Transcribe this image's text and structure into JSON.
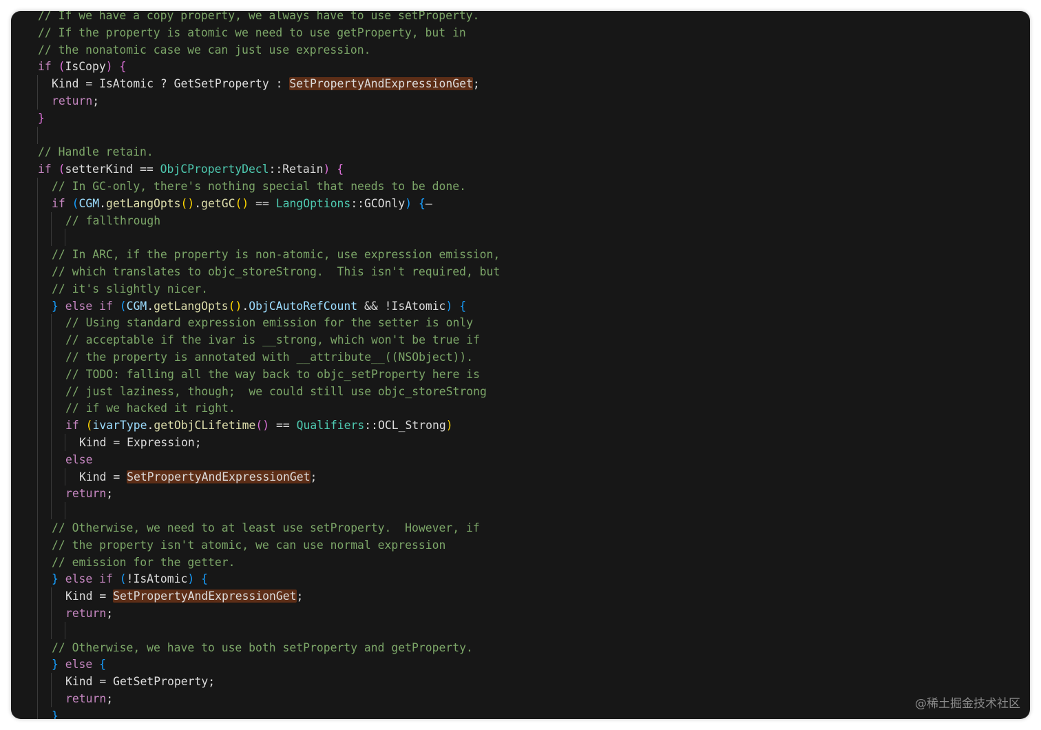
{
  "editor": {
    "lines": [
      {
        "indent": 1,
        "tokens": [
          {
            "t": "// If we have a copy property, we always have to use setProperty.",
            "c": "comment"
          }
        ]
      },
      {
        "indent": 1,
        "tokens": [
          {
            "t": "// If the property is atomic we need to use getProperty, but in",
            "c": "comment"
          }
        ]
      },
      {
        "indent": 1,
        "tokens": [
          {
            "t": "// the nonatomic case we can just use expression.",
            "c": "comment"
          }
        ]
      },
      {
        "indent": 1,
        "tokens": [
          {
            "t": "if",
            "c": "keyword"
          },
          {
            "t": " ",
            "c": "text"
          },
          {
            "t": "(",
            "c": "brace1"
          },
          {
            "t": "IsCopy",
            "c": "text"
          },
          {
            "t": ")",
            "c": "brace1"
          },
          {
            "t": " ",
            "c": "text"
          },
          {
            "t": "{",
            "c": "brace1"
          }
        ]
      },
      {
        "indent": 2,
        "tokens": [
          {
            "t": "Kind = IsAtomic ? GetSetProperty : ",
            "c": "text"
          },
          {
            "t": "SetPropertyAndExpressionGet",
            "c": "hl"
          },
          {
            "t": ";",
            "c": "text"
          }
        ]
      },
      {
        "indent": 2,
        "tokens": [
          {
            "t": "return",
            "c": "keyword"
          },
          {
            "t": ";",
            "c": "text"
          }
        ]
      },
      {
        "indent": 1,
        "tokens": [
          {
            "t": "}",
            "c": "brace1"
          }
        ]
      },
      {
        "indent": 1,
        "tokens": []
      },
      {
        "indent": 1,
        "tokens": [
          {
            "t": "// Handle retain.",
            "c": "comment"
          }
        ]
      },
      {
        "indent": 1,
        "tokens": [
          {
            "t": "if",
            "c": "keyword"
          },
          {
            "t": " ",
            "c": "text"
          },
          {
            "t": "(",
            "c": "brace1"
          },
          {
            "t": "setterKind == ",
            "c": "text"
          },
          {
            "t": "ObjCPropertyDecl",
            "c": "type"
          },
          {
            "t": "::Retain",
            "c": "text"
          },
          {
            "t": ")",
            "c": "brace1"
          },
          {
            "t": " ",
            "c": "text"
          },
          {
            "t": "{",
            "c": "brace1"
          }
        ]
      },
      {
        "indent": 2,
        "tokens": [
          {
            "t": "// In GC-only, there's nothing special that needs to be done.",
            "c": "comment"
          }
        ]
      },
      {
        "indent": 2,
        "tokens": [
          {
            "t": "if",
            "c": "keyword"
          },
          {
            "t": " ",
            "c": "text"
          },
          {
            "t": "(",
            "c": "brace2"
          },
          {
            "t": "CGM",
            "c": "var"
          },
          {
            "t": ".",
            "c": "text"
          },
          {
            "t": "getLangOpts",
            "c": "func"
          },
          {
            "t": "()",
            "c": "brace3"
          },
          {
            "t": ".",
            "c": "text"
          },
          {
            "t": "getGC",
            "c": "func"
          },
          {
            "t": "()",
            "c": "brace3"
          },
          {
            "t": " == ",
            "c": "text"
          },
          {
            "t": "LangOptions",
            "c": "type"
          },
          {
            "t": "::GCOnly",
            "c": "text"
          },
          {
            "t": ")",
            "c": "brace2"
          },
          {
            "t": " ",
            "c": "text"
          },
          {
            "t": "{",
            "c": "brace2"
          },
          {
            "t": "—",
            "c": "text"
          }
        ]
      },
      {
        "indent": 3,
        "tokens": [
          {
            "t": "// fallthrough",
            "c": "comment"
          }
        ]
      },
      {
        "indent": 3,
        "tokens": []
      },
      {
        "indent": 2,
        "tokens": [
          {
            "t": "// In ARC, if the property is non-atomic, use expression emission,",
            "c": "comment"
          }
        ]
      },
      {
        "indent": 2,
        "tokens": [
          {
            "t": "// which translates to objc_storeStrong.  This isn't required, but",
            "c": "comment"
          }
        ]
      },
      {
        "indent": 2,
        "tokens": [
          {
            "t": "// it's slightly nicer.",
            "c": "comment"
          }
        ]
      },
      {
        "indent": 2,
        "tokens": [
          {
            "t": "}",
            "c": "brace2"
          },
          {
            "t": " ",
            "c": "text"
          },
          {
            "t": "else if",
            "c": "keyword"
          },
          {
            "t": " ",
            "c": "text"
          },
          {
            "t": "(",
            "c": "brace2"
          },
          {
            "t": "CGM",
            "c": "var"
          },
          {
            "t": ".",
            "c": "text"
          },
          {
            "t": "getLangOpts",
            "c": "func"
          },
          {
            "t": "()",
            "c": "brace3"
          },
          {
            "t": ".",
            "c": "text"
          },
          {
            "t": "ObjCAutoRefCount",
            "c": "var"
          },
          {
            "t": " && !IsAtomic",
            "c": "text"
          },
          {
            "t": ")",
            "c": "brace2"
          },
          {
            "t": " ",
            "c": "text"
          },
          {
            "t": "{",
            "c": "brace2"
          }
        ]
      },
      {
        "indent": 3,
        "tokens": [
          {
            "t": "// Using standard expression emission for the setter is only",
            "c": "comment"
          }
        ]
      },
      {
        "indent": 3,
        "tokens": [
          {
            "t": "// acceptable if the ivar is __strong, which won't be true if",
            "c": "comment"
          }
        ]
      },
      {
        "indent": 3,
        "tokens": [
          {
            "t": "// the property is annotated with __attribute__((NSObject)).",
            "c": "comment"
          }
        ]
      },
      {
        "indent": 3,
        "tokens": [
          {
            "t": "// TODO: falling all the way back to objc_setProperty here is",
            "c": "comment"
          }
        ]
      },
      {
        "indent": 3,
        "tokens": [
          {
            "t": "// just laziness, though;  we could still use objc_storeStrong",
            "c": "comment"
          }
        ]
      },
      {
        "indent": 3,
        "tokens": [
          {
            "t": "// if we hacked it right.",
            "c": "comment"
          }
        ]
      },
      {
        "indent": 3,
        "tokens": [
          {
            "t": "if",
            "c": "keyword"
          },
          {
            "t": " ",
            "c": "text"
          },
          {
            "t": "(",
            "c": "brace3"
          },
          {
            "t": "ivarType",
            "c": "var"
          },
          {
            "t": ".",
            "c": "text"
          },
          {
            "t": "getObjCLifetime",
            "c": "func"
          },
          {
            "t": "()",
            "c": "brace1"
          },
          {
            "t": " == ",
            "c": "text"
          },
          {
            "t": "Qualifiers",
            "c": "type"
          },
          {
            "t": "::OCL_Strong",
            "c": "text"
          },
          {
            "t": ")",
            "c": "brace3"
          }
        ]
      },
      {
        "indent": 4,
        "tokens": [
          {
            "t": "Kind = Expression;",
            "c": "text"
          }
        ]
      },
      {
        "indent": 3,
        "tokens": [
          {
            "t": "else",
            "c": "keyword"
          }
        ]
      },
      {
        "indent": 4,
        "tokens": [
          {
            "t": "Kind = ",
            "c": "text"
          },
          {
            "t": "SetPropertyAndExpressionGet",
            "c": "hl"
          },
          {
            "t": ";",
            "c": "text"
          }
        ]
      },
      {
        "indent": 3,
        "tokens": [
          {
            "t": "return",
            "c": "keyword"
          },
          {
            "t": ";",
            "c": "text"
          }
        ]
      },
      {
        "indent": 3,
        "tokens": []
      },
      {
        "indent": 2,
        "tokens": [
          {
            "t": "// Otherwise, we need to at least use setProperty.  However, if",
            "c": "comment"
          }
        ]
      },
      {
        "indent": 2,
        "tokens": [
          {
            "t": "// the property isn't atomic, we can use normal expression",
            "c": "comment"
          }
        ]
      },
      {
        "indent": 2,
        "tokens": [
          {
            "t": "// emission for the getter.",
            "c": "comment"
          }
        ]
      },
      {
        "indent": 2,
        "tokens": [
          {
            "t": "}",
            "c": "brace2"
          },
          {
            "t": " ",
            "c": "text"
          },
          {
            "t": "else if",
            "c": "keyword"
          },
          {
            "t": " ",
            "c": "text"
          },
          {
            "t": "(",
            "c": "brace2"
          },
          {
            "t": "!IsAtomic",
            "c": "text"
          },
          {
            "t": ")",
            "c": "brace2"
          },
          {
            "t": " ",
            "c": "text"
          },
          {
            "t": "{",
            "c": "brace2"
          }
        ]
      },
      {
        "indent": 3,
        "tokens": [
          {
            "t": "Kind = ",
            "c": "text"
          },
          {
            "t": "SetPropertyAndExpressionGet",
            "c": "hl"
          },
          {
            "t": ";",
            "c": "text"
          }
        ]
      },
      {
        "indent": 3,
        "tokens": [
          {
            "t": "return",
            "c": "keyword"
          },
          {
            "t": ";",
            "c": "text"
          }
        ]
      },
      {
        "indent": 3,
        "tokens": []
      },
      {
        "indent": 2,
        "tokens": [
          {
            "t": "// Otherwise, we have to use both setProperty and getProperty.",
            "c": "comment"
          }
        ]
      },
      {
        "indent": 2,
        "tokens": [
          {
            "t": "}",
            "c": "brace2"
          },
          {
            "t": " ",
            "c": "text"
          },
          {
            "t": "else",
            "c": "keyword"
          },
          {
            "t": " ",
            "c": "text"
          },
          {
            "t": "{",
            "c": "brace2"
          }
        ]
      },
      {
        "indent": 3,
        "tokens": [
          {
            "t": "Kind = GetSetProperty;",
            "c": "text"
          }
        ]
      },
      {
        "indent": 3,
        "tokens": [
          {
            "t": "return",
            "c": "keyword"
          },
          {
            "t": ";",
            "c": "text"
          }
        ]
      },
      {
        "indent": 2,
        "tokens": [
          {
            "t": "}",
            "c": "brace2"
          }
        ]
      }
    ]
  },
  "watermark": "@稀土掘金技术社区"
}
